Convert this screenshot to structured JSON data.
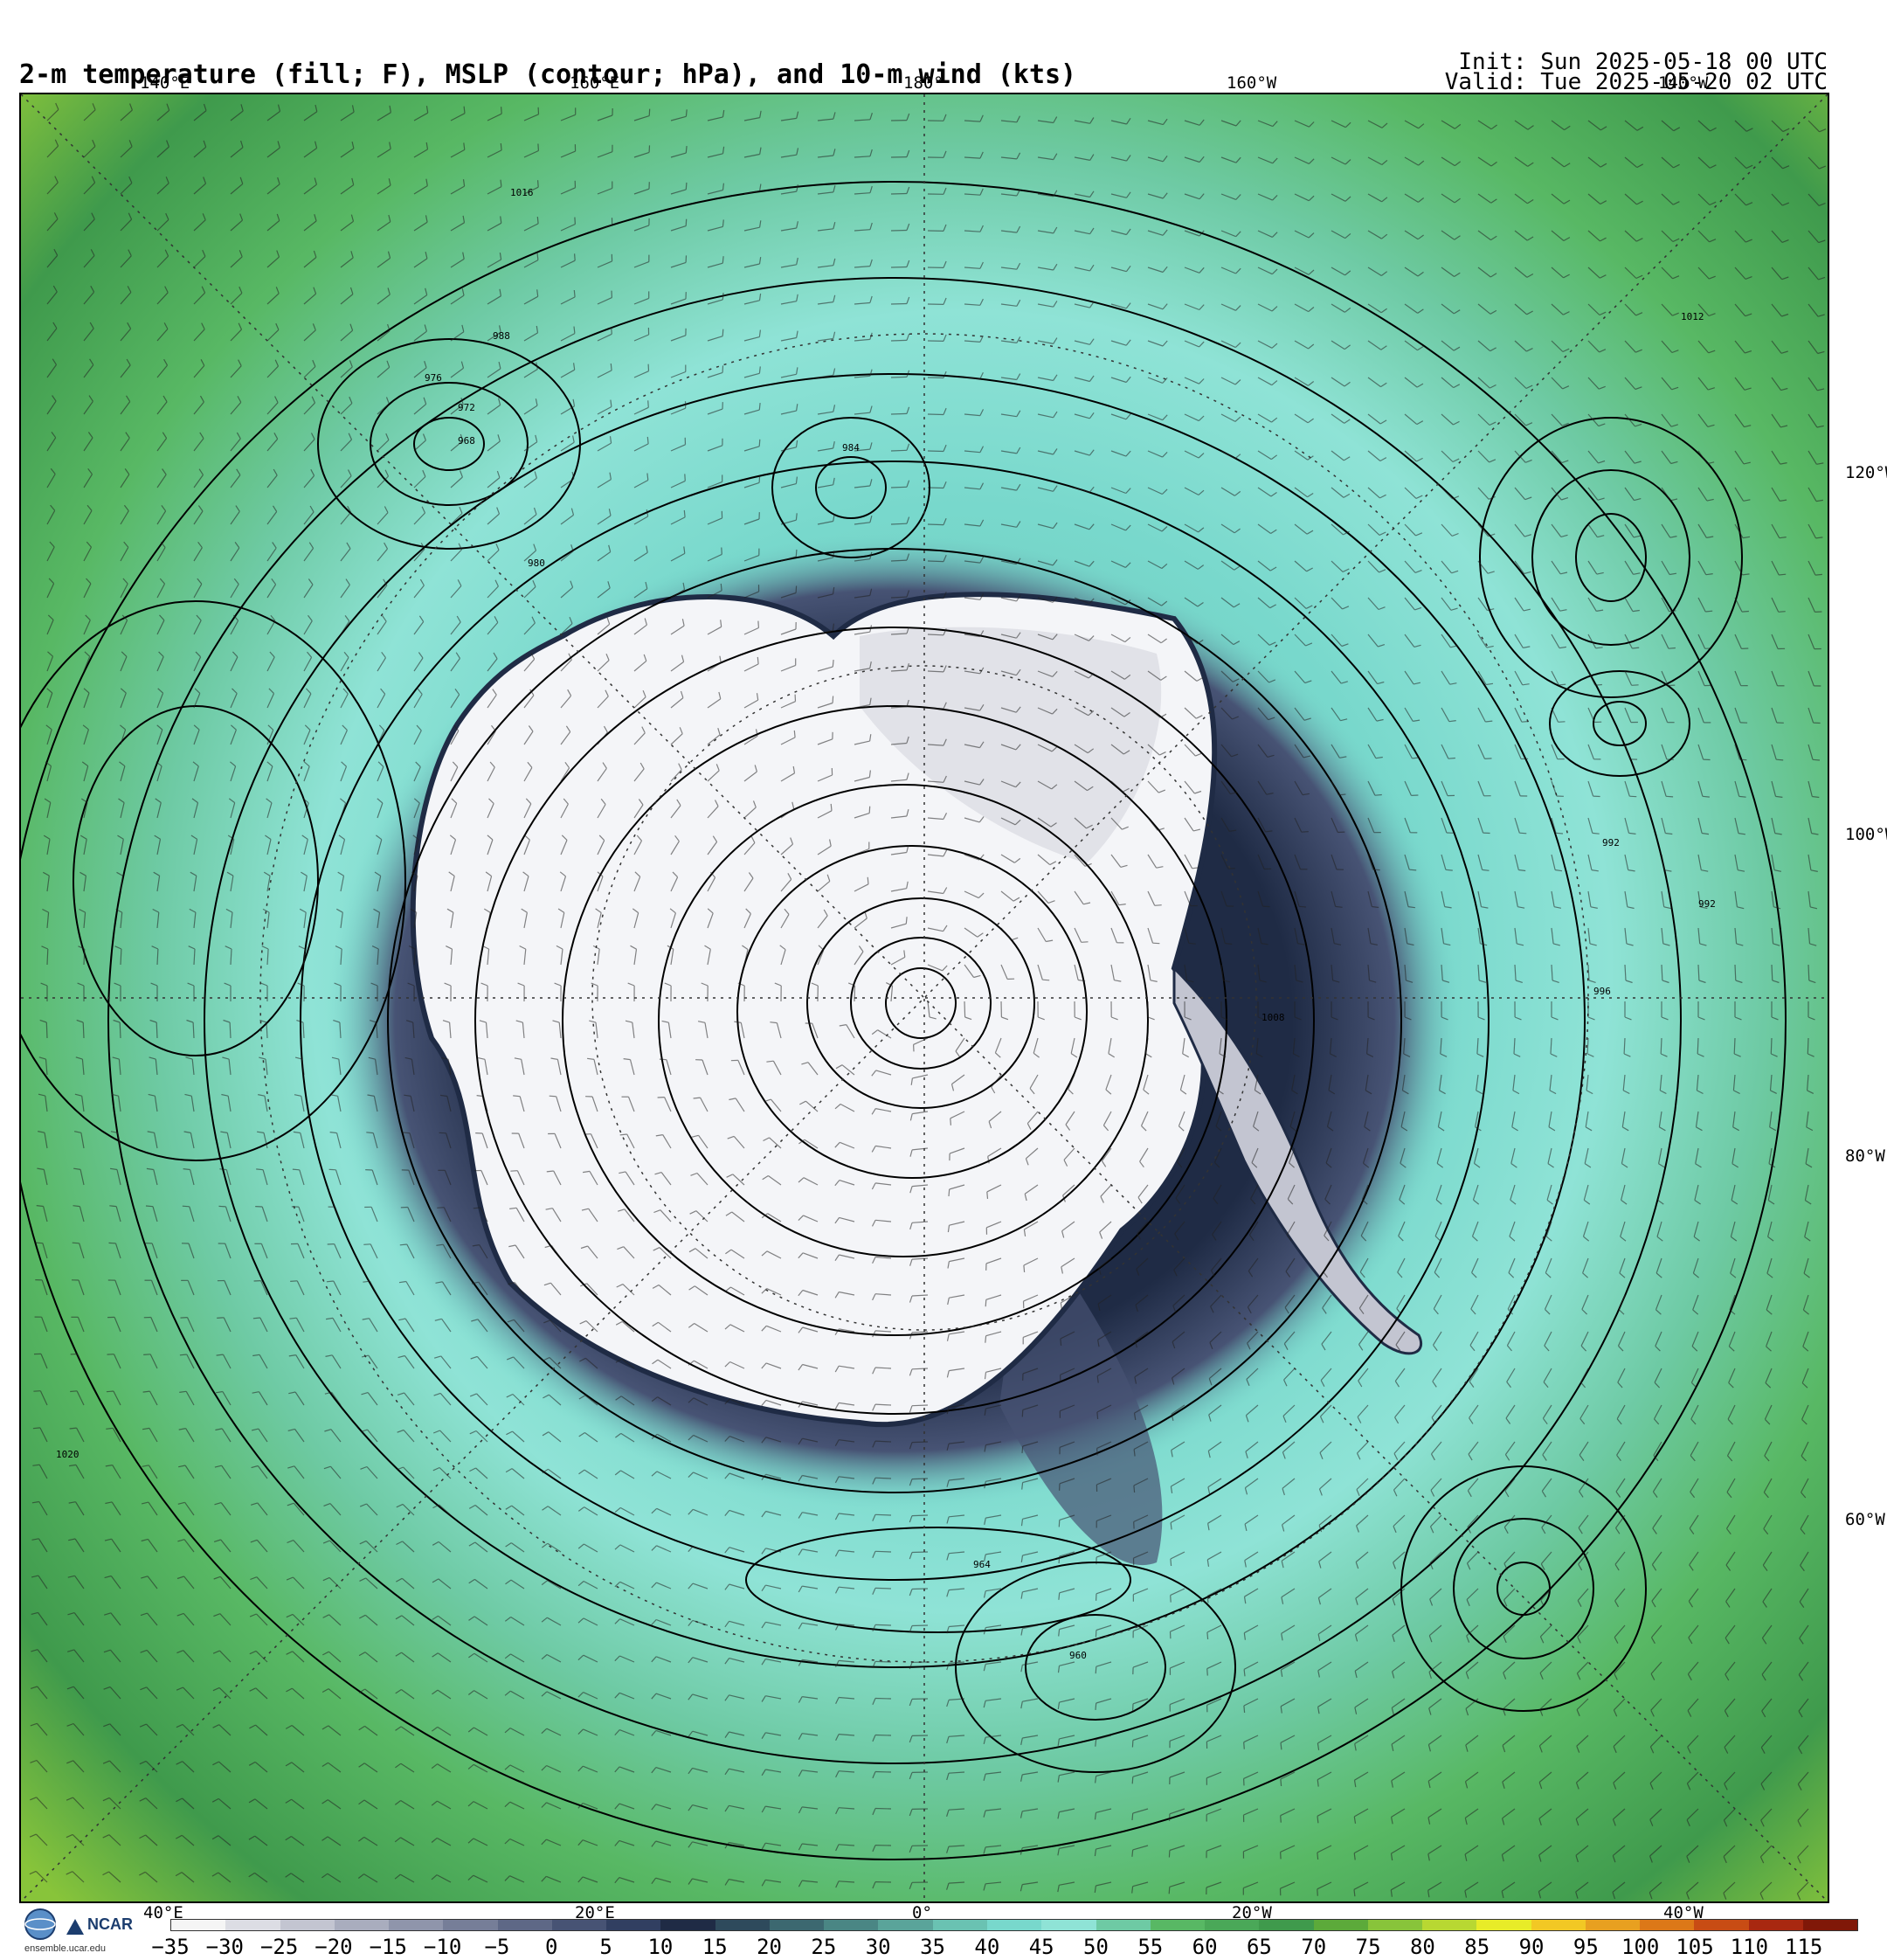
{
  "header": {
    "title": "2-m temperature (fill; F), MSLP (contour; hPa), and 10-m wind (kts)",
    "init": "Init: Sun 2025-05-18 00 UTC",
    "valid": "Valid: Tue 2025-05-20 02 UTC"
  },
  "map": {
    "projection": "south-polar-stereographic",
    "top_labels": [
      "140°E",
      "160°E",
      "180°",
      "160°W",
      "140°W"
    ],
    "right_labels": [
      "120°W",
      "100°W",
      "80°W",
      "60°W"
    ],
    "bottom_labels": [
      "40°E",
      "20°E",
      "0°",
      "20°W",
      "40°W"
    ],
    "colors": {
      "ice": "#f4f5f8",
      "cold_navy": "#1f2b45",
      "teal": "#78d8cc",
      "light_teal": "#8fe3d6",
      "green": "#58b864",
      "dark_green": "#3f9a4c",
      "yellow_green": "#88c43a"
    },
    "pressure_labels": [
      "1016",
      "988",
      "976",
      "972",
      "968",
      "980",
      "984",
      "964",
      "960",
      "1020",
      "1012",
      "1008",
      "996",
      "992"
    ]
  },
  "colorbar": {
    "ticks": [
      "−35",
      "−30",
      "−25",
      "−20",
      "−15",
      "−10",
      "−5",
      "0",
      "5",
      "10",
      "15",
      "20",
      "25",
      "30",
      "35",
      "40",
      "45",
      "50",
      "55",
      "60",
      "65",
      "70",
      "75",
      "80",
      "85",
      "90",
      "95",
      "100",
      "105",
      "110",
      "115"
    ],
    "colors": [
      "#f5f5f5",
      "#dcdde4",
      "#c3c5d1",
      "#a9adbe",
      "#8f95ab",
      "#767e98",
      "#5e6886",
      "#475374",
      "#313f61",
      "#1f2b45",
      "#2e4a5c",
      "#3c6870",
      "#4a8684",
      "#5aa49a",
      "#6ac2b2",
      "#78d8cc",
      "#8fe3d6",
      "#6ecaa4",
      "#58b864",
      "#4aa858",
      "#3f9a4c",
      "#5caa3a",
      "#88c43a",
      "#b8d832",
      "#e8ec28",
      "#f2c824",
      "#e8a020",
      "#dc7818",
      "#c84c14",
      "#a82810",
      "#801808"
    ]
  },
  "footer": {
    "org": "NCAR",
    "site": "ensemble.ucar.edu"
  }
}
